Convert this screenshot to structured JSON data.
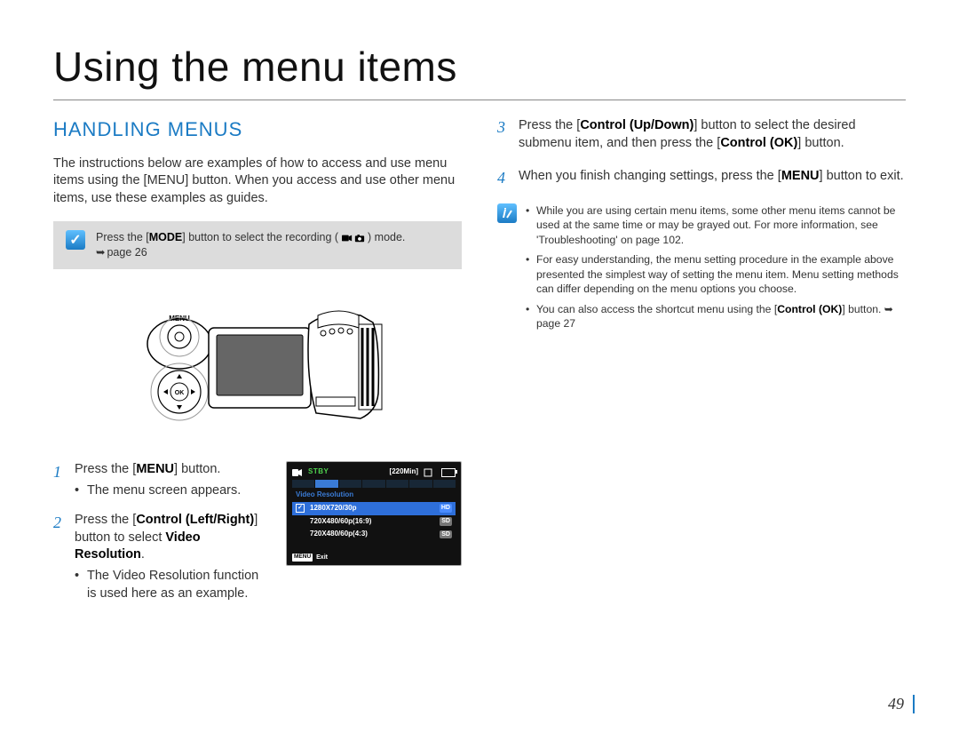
{
  "title": "Using the menu items",
  "section_heading": "HANDLING MENUS",
  "intro": "The instructions below are examples of how to access and use menu items using the [MENU] button. When you access and use other menu items, use these examples as guides.",
  "note_box": {
    "prefix": "Press the [",
    "bold": "MODE",
    "mid": "] button to select the recording (",
    "suffix": ") mode.",
    "ref": "page 26"
  },
  "camera_labels": {
    "menu": "MENU",
    "ok": "OK"
  },
  "steps_left": [
    {
      "parts": [
        "Press the [",
        "MENU",
        "] button."
      ],
      "bullets": [
        "The menu screen appears."
      ]
    },
    {
      "parts": [
        "Press the [",
        "Control (Left/Right)",
        "] button to select ",
        "Video Resolution",
        "."
      ],
      "bullets": [
        "The Video Resolution function is used here as an example."
      ]
    }
  ],
  "steps_right": [
    {
      "num": "3",
      "parts": [
        "Press the [",
        "Control (Up/Down)",
        "] button to select the desired submenu item, and then press the [",
        "Control (OK)",
        "] button."
      ]
    },
    {
      "num": "4",
      "parts": [
        "When you finish changing settings, press the [",
        "MENU",
        "] button to exit."
      ]
    }
  ],
  "right_notes": [
    "While you are using certain menu items, some other menu items cannot be used at the same time or may be grayed out. For more information, see 'Troubleshooting' on page 102.",
    "For easy understanding, the menu setting procedure in the example above presented the simplest way of setting the menu item. Menu setting methods can differ depending on the menu options you choose."
  ],
  "right_note_last": {
    "pre": "You can also access the shortcut menu using the [",
    "bold": "Control (OK)",
    "post": "] button. ",
    "ref": "page 27"
  },
  "screenshot": {
    "stby": "STBY",
    "time": "[220Min]",
    "heading": "Video Resolution",
    "rows": [
      {
        "res": "1280X720/30p",
        "badge": "HD",
        "selected": true
      },
      {
        "res": "720X480/60p(16:9)",
        "badge": "SD",
        "selected": false
      },
      {
        "res": "720X480/60p(4:3)",
        "badge": "SD",
        "selected": false
      }
    ],
    "exit_label": "Exit",
    "menu_tag": "MENU"
  },
  "page_number": "49"
}
